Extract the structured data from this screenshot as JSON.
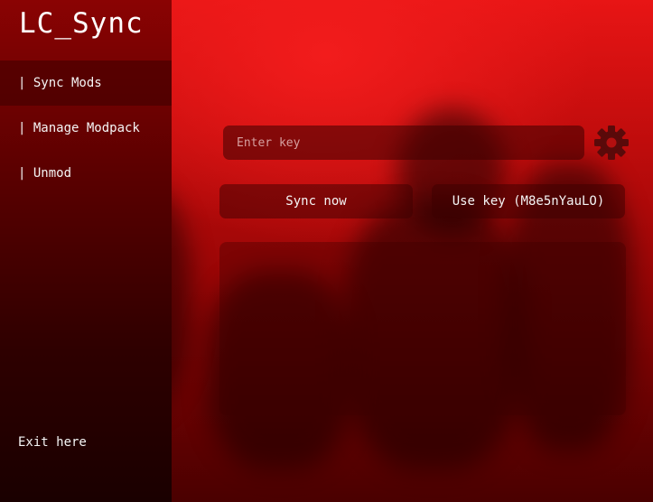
{
  "app": {
    "title": "LC_Sync"
  },
  "sidebar": {
    "items": [
      {
        "label": "| Sync Mods",
        "active": true
      },
      {
        "label": "| Manage Modpack",
        "active": false
      },
      {
        "label": "| Unmod",
        "active": false
      }
    ],
    "exit_label": "Exit here"
  },
  "main": {
    "key_input": {
      "value": "",
      "placeholder": "Enter key"
    },
    "settings_icon": "gear-icon",
    "sync_button_label": "Sync now",
    "use_key_button_label": "Use key (M8e5nYauLO)"
  },
  "colors": {
    "accent": "#e81515",
    "sidebar_top": "#8a0303",
    "sidebar_bottom": "#1a0000",
    "gear": "#5a0a0a"
  }
}
